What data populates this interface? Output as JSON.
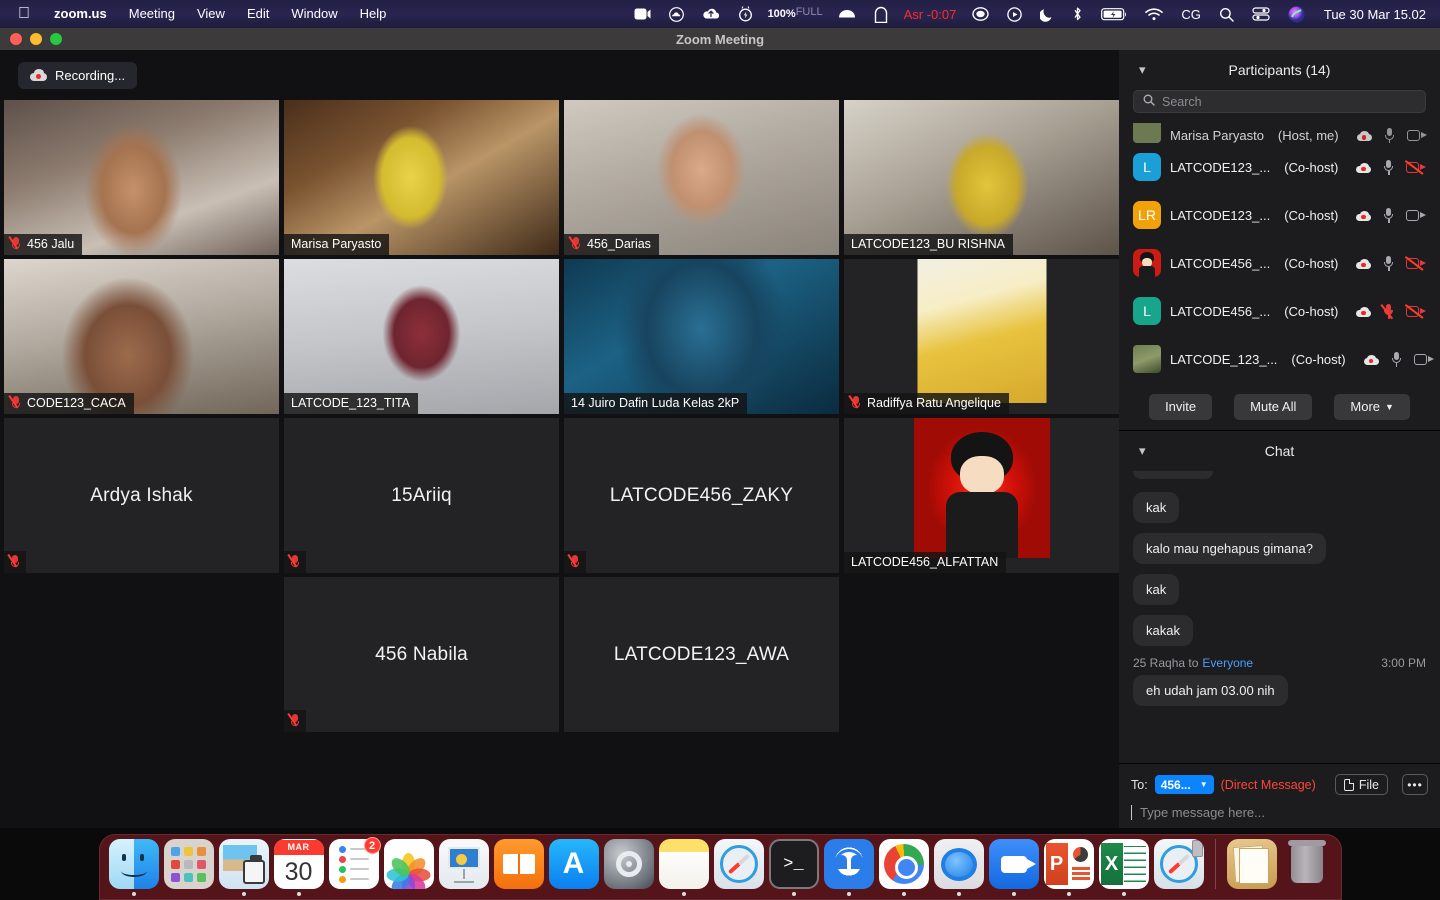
{
  "menubar": {
    "apple": "apple-logo",
    "items": [
      "zoom.us",
      "Meeting",
      "View",
      "Edit",
      "Window",
      "Help"
    ],
    "battery_percent": "100%",
    "battery_state": "FULL",
    "prayer_timer": "Asr -0:07",
    "keyboard_layout": "CG",
    "datetime": "Tue 30 Mar  15.02",
    "right_icons": [
      "screen-record-icon",
      "cloud-icon",
      "cloud-upload-icon",
      "battery-health-icon",
      "bowl-icon",
      "arch-icon",
      "chat-bubble-icon",
      "play-circle-icon",
      "moon-icon",
      "bluetooth-icon",
      "battery-icon",
      "wifi-icon",
      "search-icon",
      "control-center-icon",
      "siri-icon"
    ]
  },
  "window": {
    "title": "Zoom Meeting",
    "recording_label": "Recording..."
  },
  "tiles": [
    {
      "name": "456 Jalu",
      "style": "p-jalu",
      "muted": true,
      "label_pos": "bottom",
      "active": false
    },
    {
      "name": "Marisa Paryasto",
      "style": "p-marisa",
      "muted": false,
      "label_pos": "bottom",
      "active": true
    },
    {
      "name": "456_Darias",
      "style": "p-darias",
      "muted": true,
      "label_pos": "bottom",
      "active": false
    },
    {
      "name": "LATCODE123_BU RISHNA",
      "style": "p-rishna",
      "muted": false,
      "label_pos": "bottom",
      "active": false
    },
    {
      "name": "CODE123_CACA",
      "style": "p-caca",
      "muted": true,
      "label_pos": "bottom",
      "active": false
    },
    {
      "name": "LATCODE_123_TITA",
      "style": "p-tita",
      "muted": false,
      "label_pos": "bottom",
      "active": false
    },
    {
      "name": "14 Juiro Dafin Luda  Kelas  2kP",
      "style": "p-dafin",
      "muted": false,
      "label_pos": "bottom",
      "active": false
    },
    {
      "name": "Radiffya Ratu Angelique",
      "style": "p-radiffya",
      "muted": true,
      "label_pos": "bottom",
      "active": false
    },
    {
      "name": "Ardya Ishak",
      "style": "",
      "muted": true,
      "label_pos": "center",
      "active": false
    },
    {
      "name": "15Ariiq",
      "style": "",
      "muted": true,
      "label_pos": "center",
      "active": false
    },
    {
      "name": "LATCODE456_ZAKY",
      "style": "",
      "muted": true,
      "label_pos": "center",
      "active": false
    },
    {
      "name": "LATCODE456_ALFATTAN",
      "style": "p-alfattan",
      "muted": false,
      "label_pos": "bottom",
      "active": false
    },
    {
      "name": "456 Nabila",
      "style": "",
      "muted": true,
      "label_pos": "center",
      "active": false
    },
    {
      "name": "LATCODE123_AWA",
      "style": "",
      "muted": false,
      "label_pos": "center",
      "active": false
    }
  ],
  "participants": {
    "title": "Participants (14)",
    "search_placeholder": "Search",
    "clipped_row": {
      "name": "Marisa Paryasto",
      "role": "(Host, me)"
    },
    "rows": [
      {
        "initials": "L",
        "avatar_color": "#1a9fd6",
        "name": "LATCODE123_...",
        "role": "(Co-host)",
        "recording": true,
        "mic_off": false,
        "cam_off": true,
        "photo": false
      },
      {
        "initials": "LR",
        "avatar_color": "#f2a209",
        "name": "LATCODE123_...",
        "role": "(Co-host)",
        "recording": true,
        "mic_off": false,
        "cam_off": false,
        "photo": false
      },
      {
        "initials": "",
        "avatar_color": "#cc1a14",
        "name": "LATCODE456_...",
        "role": "(Co-host)",
        "recording": true,
        "mic_off": false,
        "cam_off": true,
        "photo": "anime"
      },
      {
        "initials": "L",
        "avatar_color": "#17a58c",
        "name": "LATCODE456_...",
        "role": "(Co-host)",
        "recording": true,
        "mic_off": true,
        "cam_off": true,
        "photo": false
      },
      {
        "initials": "",
        "avatar_color": "#7a8a5a",
        "name": "LATCODE_123_...",
        "role": "(Co-host)",
        "recording": true,
        "mic_off": false,
        "cam_off": false,
        "photo": "hijab"
      }
    ],
    "buttons": {
      "invite": "Invite",
      "mute_all": "Mute All",
      "more": "More"
    }
  },
  "chat": {
    "title": "Chat",
    "messages": [
      {
        "type": "bubble-clipped",
        "text": ""
      },
      {
        "type": "bubble",
        "text": "kak"
      },
      {
        "type": "bubble",
        "text": "kalo mau ngehapus gimana?"
      },
      {
        "type": "bubble",
        "text": "kak"
      },
      {
        "type": "bubble",
        "text": "kakak"
      },
      {
        "type": "meta",
        "sender": "25 Raqha to",
        "target": "Everyone",
        "time": "3:00 PM"
      },
      {
        "type": "bubble",
        "text": "eh udah jam 03.00 nih"
      }
    ],
    "composer": {
      "to_label": "To:",
      "to_value": "456...",
      "direct_message": "(Direct Message)",
      "file_label": "File",
      "more_label": "•••",
      "input_placeholder": "Type message here..."
    }
  },
  "dock": {
    "items": [
      {
        "name": "finder",
        "running": true,
        "badge": ""
      },
      {
        "name": "launchpad",
        "running": false,
        "badge": ""
      },
      {
        "name": "preview",
        "running": true,
        "badge": ""
      },
      {
        "name": "calendar",
        "running": true,
        "badge": "",
        "month": "MAR",
        "day": "30"
      },
      {
        "name": "reminders",
        "running": false,
        "badge": "2"
      },
      {
        "name": "photos",
        "running": false,
        "badge": ""
      },
      {
        "name": "keynote",
        "running": false,
        "badge": ""
      },
      {
        "name": "books",
        "running": false,
        "badge": ""
      },
      {
        "name": "app-store",
        "running": false,
        "badge": ""
      },
      {
        "name": "system-preferences",
        "running": false,
        "badge": ""
      },
      {
        "name": "notes",
        "running": true,
        "badge": ""
      },
      {
        "name": "safari-old",
        "running": false,
        "badge": ""
      },
      {
        "name": "terminal",
        "running": true,
        "badge": ""
      },
      {
        "name": "zoom-browser",
        "running": true,
        "badge": ""
      },
      {
        "name": "chrome",
        "running": true,
        "badge": ""
      },
      {
        "name": "messages",
        "running": true,
        "badge": ""
      },
      {
        "name": "zoom",
        "running": true,
        "badge": ""
      },
      {
        "name": "powerpoint",
        "running": true,
        "badge": ""
      },
      {
        "name": "excel",
        "running": true,
        "badge": ""
      },
      {
        "name": "safari",
        "running": false,
        "badge": ""
      },
      {
        "name": "documents-stack",
        "running": false,
        "badge": ""
      },
      {
        "name": "trash",
        "running": false,
        "badge": ""
      }
    ]
  }
}
